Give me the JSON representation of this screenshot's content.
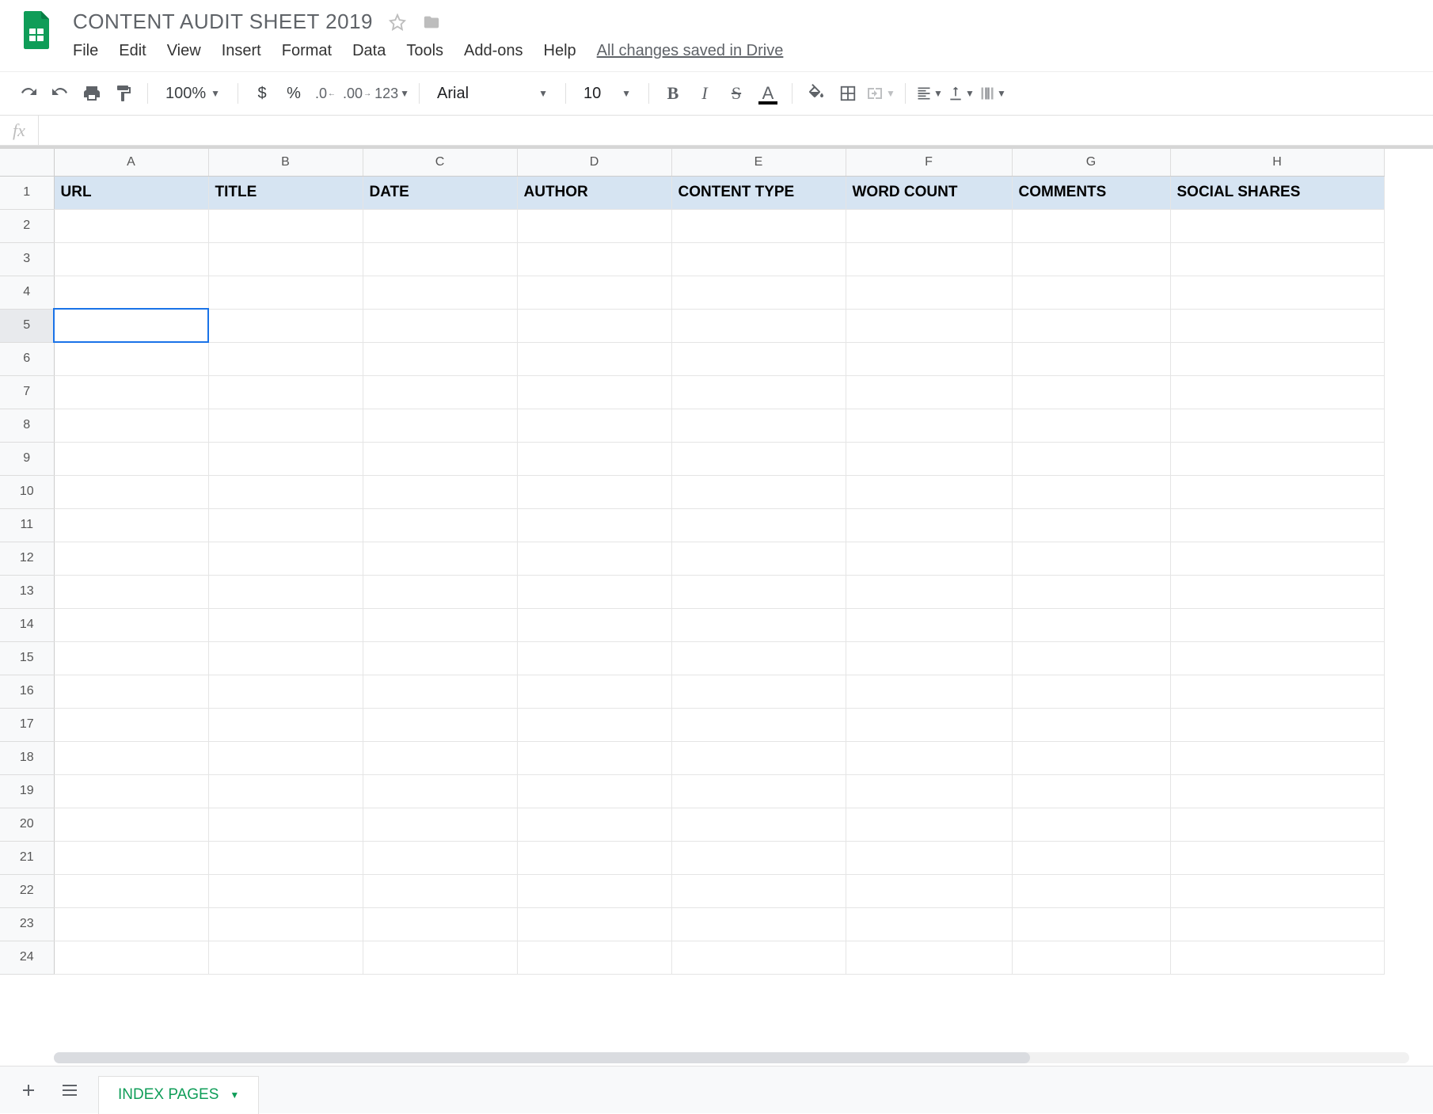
{
  "doc": {
    "title": "CONTENT AUDIT SHEET 2019",
    "save_status": "All changes saved in Drive"
  },
  "menu": {
    "file": "File",
    "edit": "Edit",
    "view": "View",
    "insert": "Insert",
    "format": "Format",
    "data": "Data",
    "tools": "Tools",
    "addons": "Add-ons",
    "help": "Help"
  },
  "toolbar": {
    "zoom": "100%",
    "currency": "$",
    "percent": "%",
    "dec_minus": ".0",
    "dec_plus": ".00",
    "more_fmt": "123",
    "font": "Arial",
    "font_size": "10"
  },
  "formula": {
    "fx": "fx",
    "value": ""
  },
  "grid": {
    "columns": [
      "A",
      "B",
      "C",
      "D",
      "E",
      "F",
      "G",
      "H"
    ],
    "rows": [
      "1",
      "2",
      "3",
      "4",
      "5",
      "6",
      "7",
      "8",
      "9",
      "10",
      "11",
      "12",
      "13",
      "14",
      "15",
      "16",
      "17",
      "18",
      "19",
      "20",
      "21",
      "22",
      "23",
      "24"
    ],
    "header_row": {
      "A": "URL",
      "B": "TITLE",
      "C": "DATE",
      "D": "AUTHOR",
      "E": "CONTENT TYPE",
      "F": "WORD COUNT",
      "G": "COMMENTS",
      "H": "SOCIAL SHARES"
    },
    "selected_cell": "A5"
  },
  "sheets": {
    "active": "INDEX PAGES"
  }
}
